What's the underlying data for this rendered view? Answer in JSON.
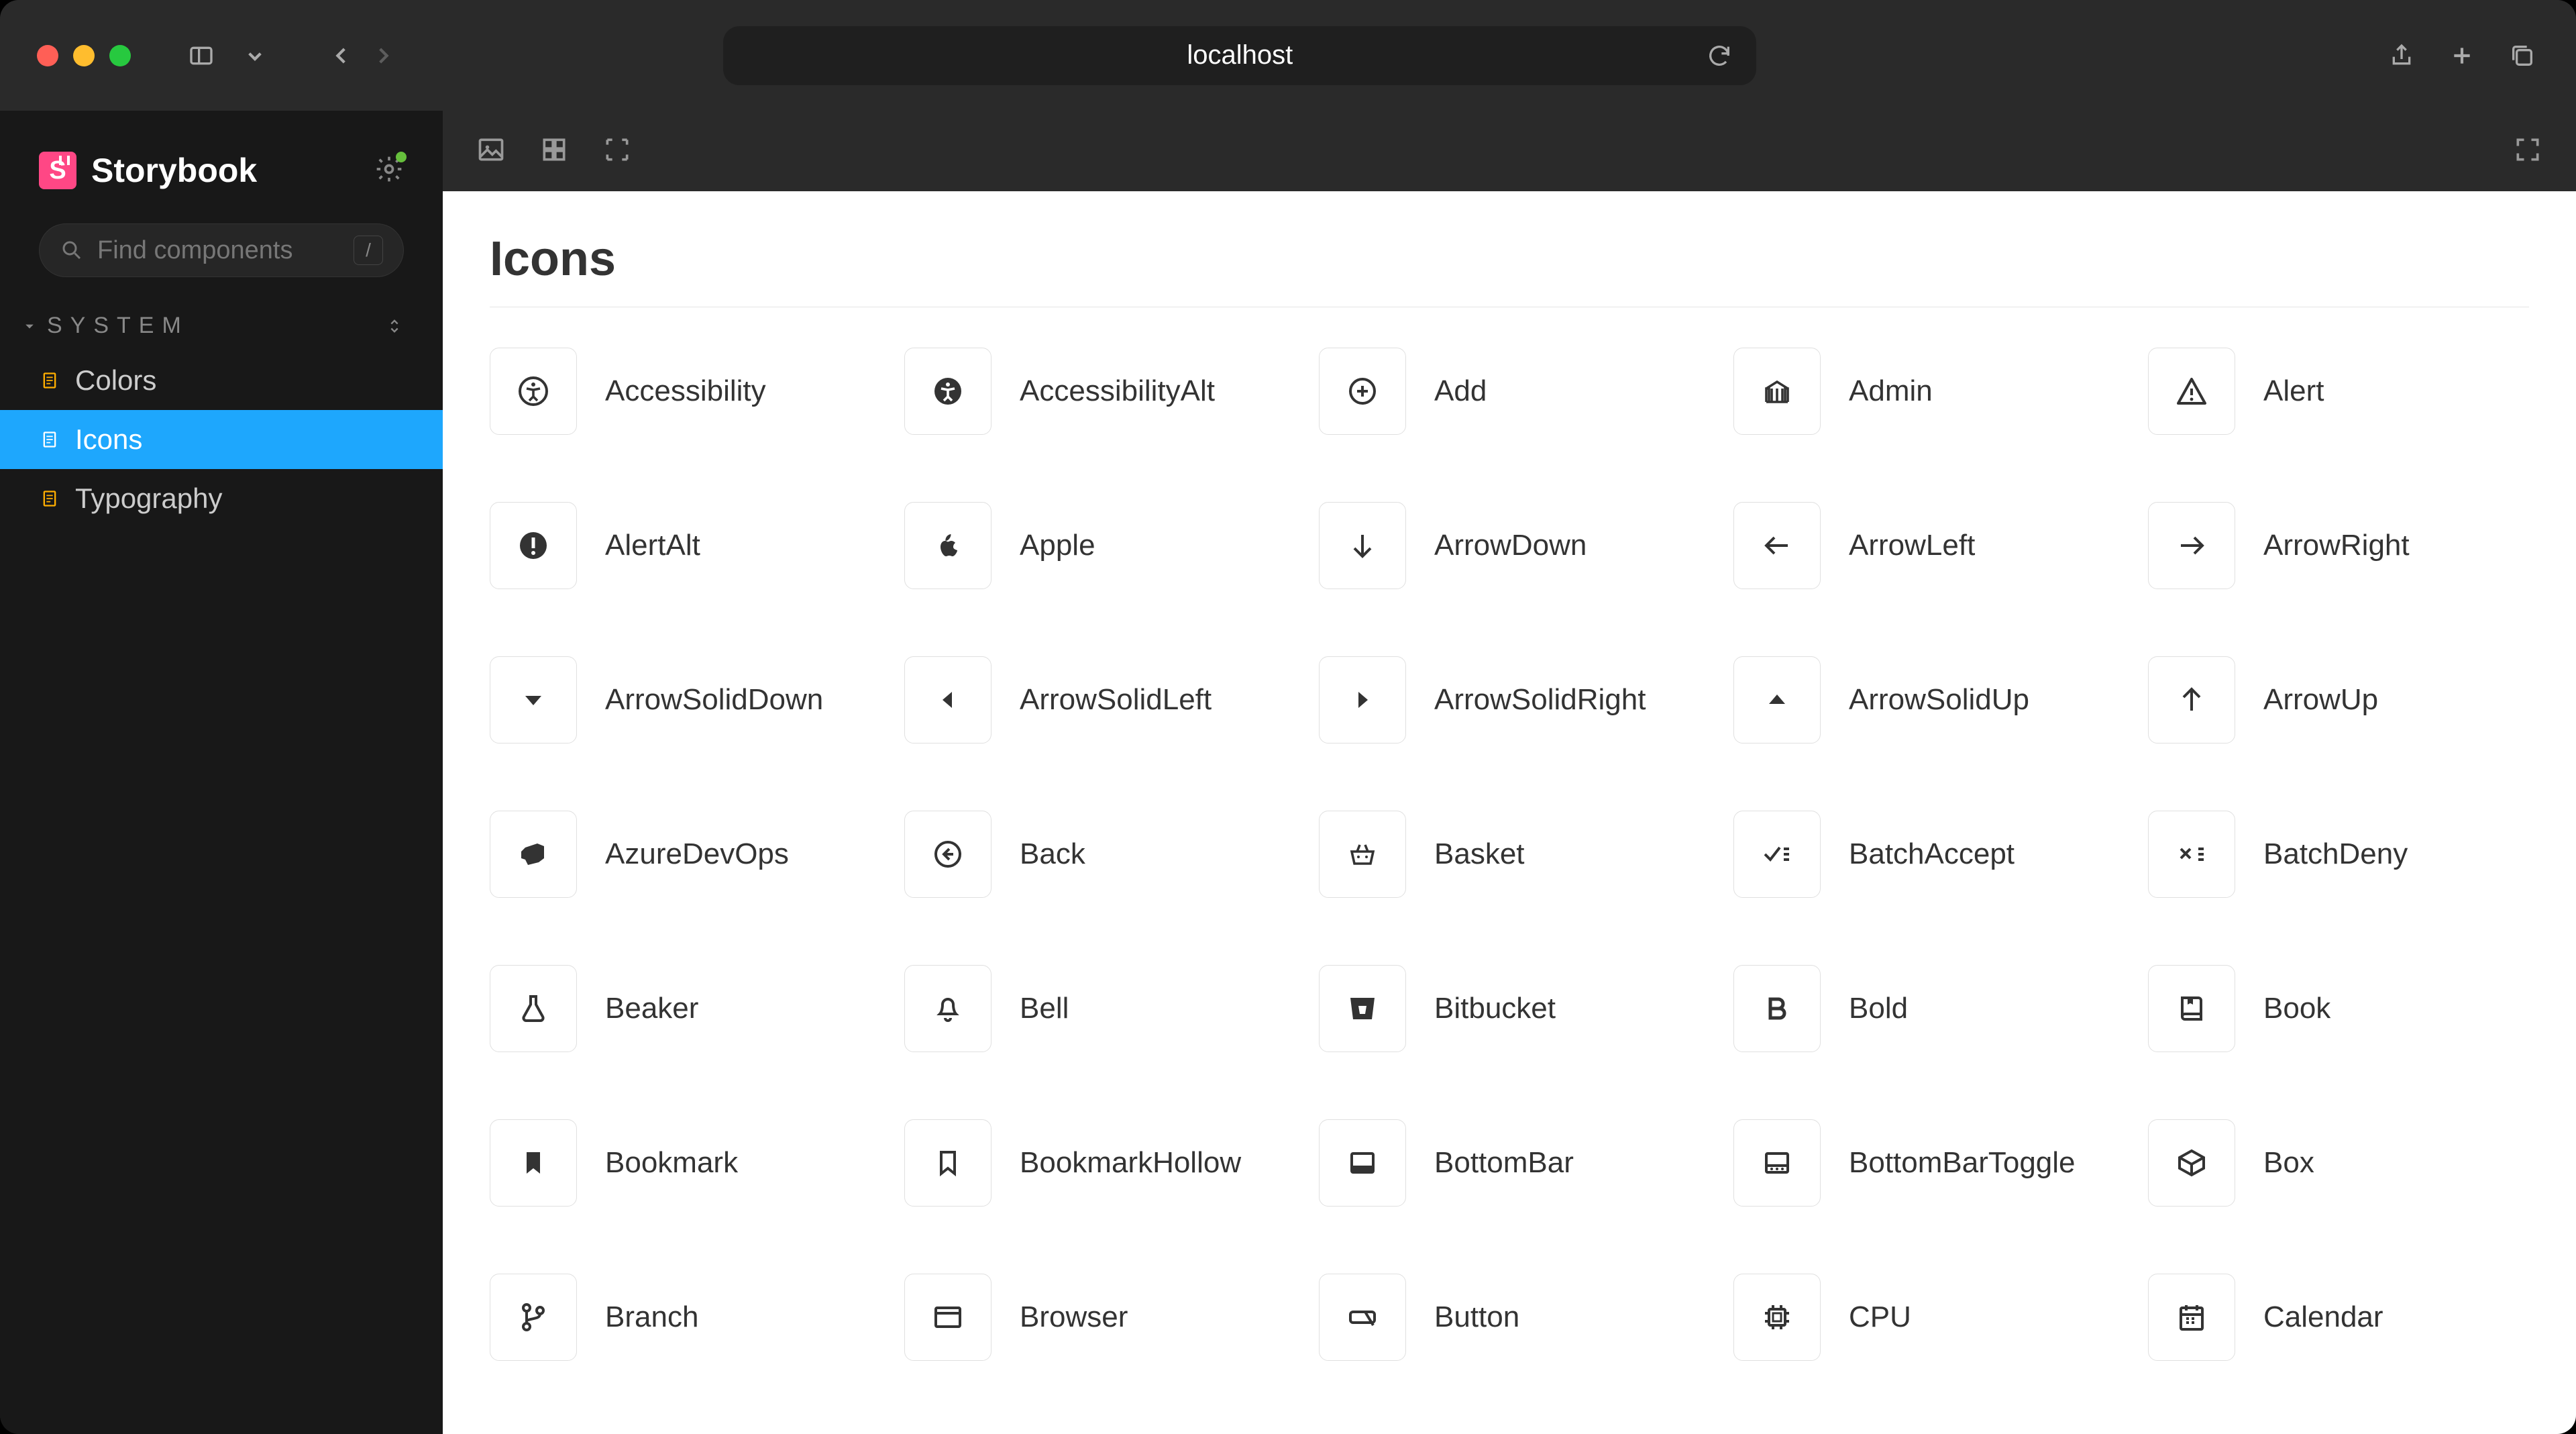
{
  "browser": {
    "address": "localhost"
  },
  "sidebar": {
    "app_name": "Storybook",
    "search_placeholder": "Find components",
    "search_key": "/",
    "category": "SYSTEM",
    "items": [
      {
        "label": "Colors"
      },
      {
        "label": "Icons"
      },
      {
        "label": "Typography"
      }
    ]
  },
  "page": {
    "title": "Icons",
    "icons": [
      {
        "name": "Accessibility",
        "glyph": "accessibility"
      },
      {
        "name": "AccessibilityAlt",
        "glyph": "accessibility-alt"
      },
      {
        "name": "Add",
        "glyph": "add"
      },
      {
        "name": "Admin",
        "glyph": "admin"
      },
      {
        "name": "Alert",
        "glyph": "alert"
      },
      {
        "name": "AlertAlt",
        "glyph": "alert-alt"
      },
      {
        "name": "Apple",
        "glyph": "apple"
      },
      {
        "name": "ArrowDown",
        "glyph": "arrow-down"
      },
      {
        "name": "ArrowLeft",
        "glyph": "arrow-left"
      },
      {
        "name": "ArrowRight",
        "glyph": "arrow-right"
      },
      {
        "name": "ArrowSolidDown",
        "glyph": "arrow-solid-down"
      },
      {
        "name": "ArrowSolidLeft",
        "glyph": "arrow-solid-left"
      },
      {
        "name": "ArrowSolidRight",
        "glyph": "arrow-solid-right"
      },
      {
        "name": "ArrowSolidUp",
        "glyph": "arrow-solid-up"
      },
      {
        "name": "ArrowUp",
        "glyph": "arrow-up"
      },
      {
        "name": "AzureDevOps",
        "glyph": "azure-devops"
      },
      {
        "name": "Back",
        "glyph": "back"
      },
      {
        "name": "Basket",
        "glyph": "basket"
      },
      {
        "name": "BatchAccept",
        "glyph": "batch-accept"
      },
      {
        "name": "BatchDeny",
        "glyph": "batch-deny"
      },
      {
        "name": "Beaker",
        "glyph": "beaker"
      },
      {
        "name": "Bell",
        "glyph": "bell"
      },
      {
        "name": "Bitbucket",
        "glyph": "bitbucket"
      },
      {
        "name": "Bold",
        "glyph": "bold"
      },
      {
        "name": "Book",
        "glyph": "book"
      },
      {
        "name": "Bookmark",
        "glyph": "bookmark"
      },
      {
        "name": "BookmarkHollow",
        "glyph": "bookmark-hollow"
      },
      {
        "name": "BottomBar",
        "glyph": "bottom-bar"
      },
      {
        "name": "BottomBarToggle",
        "glyph": "bottom-bar-toggle"
      },
      {
        "name": "Box",
        "glyph": "box"
      },
      {
        "name": "Branch",
        "glyph": "branch"
      },
      {
        "name": "Browser",
        "glyph": "browser"
      },
      {
        "name": "Button",
        "glyph": "button"
      },
      {
        "name": "CPU",
        "glyph": "cpu"
      },
      {
        "name": "Calendar",
        "glyph": "calendar"
      }
    ]
  }
}
